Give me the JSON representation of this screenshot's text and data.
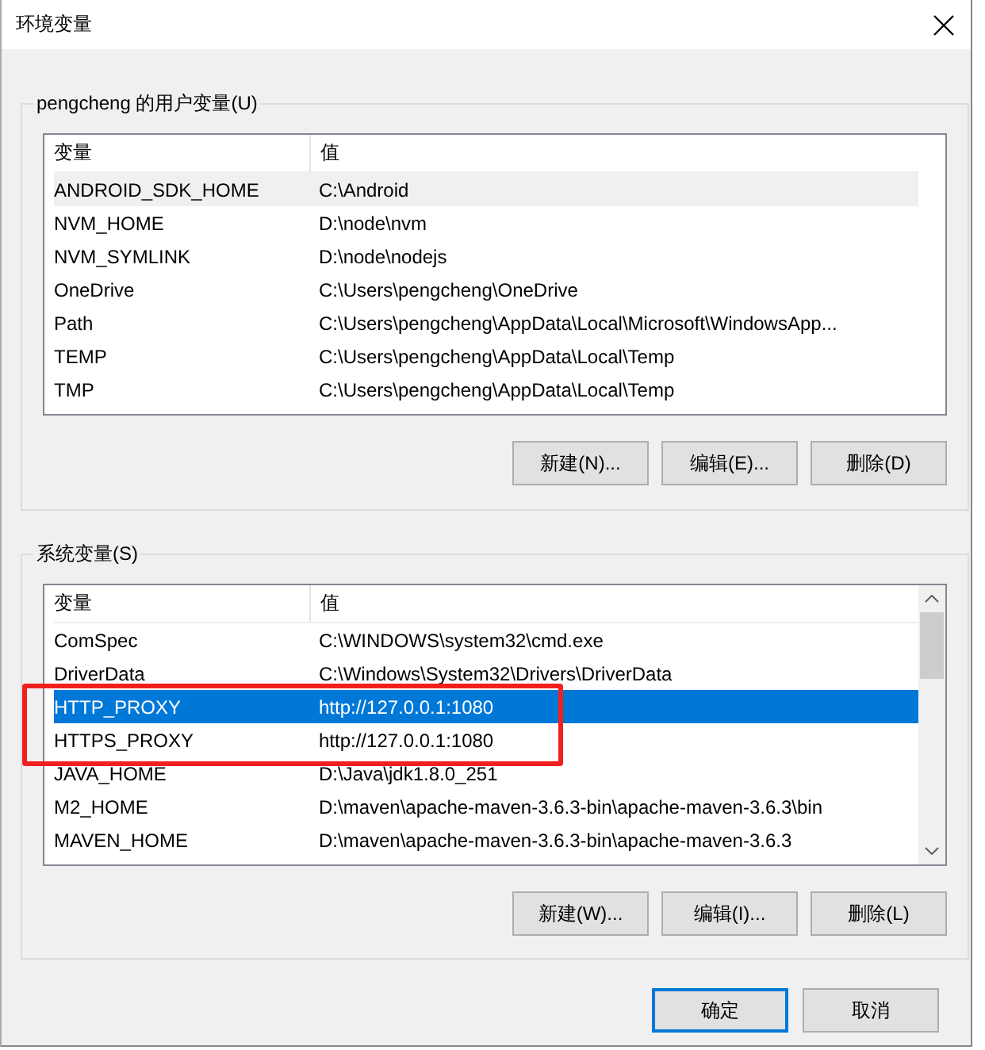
{
  "window": {
    "title": "环境变量"
  },
  "user_variables": {
    "label": "pengcheng 的用户变量(U)",
    "focused": false,
    "scrollbar": false,
    "columns": [
      "变量",
      "值"
    ],
    "rows": [
      {
        "name": "ANDROID_SDK_HOME",
        "value": "C:\\Android",
        "selected": true
      },
      {
        "name": "NVM_HOME",
        "value": "D:\\node\\nvm",
        "selected": false
      },
      {
        "name": "NVM_SYMLINK",
        "value": "D:\\node\\nodejs",
        "selected": false
      },
      {
        "name": "OneDrive",
        "value": "C:\\Users\\pengcheng\\OneDrive",
        "selected": false
      },
      {
        "name": "Path",
        "value": "C:\\Users\\pengcheng\\AppData\\Local\\Microsoft\\WindowsApp...",
        "selected": false
      },
      {
        "name": "TEMP",
        "value": "C:\\Users\\pengcheng\\AppData\\Local\\Temp",
        "selected": false
      },
      {
        "name": "TMP",
        "value": "C:\\Users\\pengcheng\\AppData\\Local\\Temp",
        "selected": false
      }
    ],
    "buttons": [
      "新建(N)...",
      "编辑(E)...",
      "删除(D)"
    ]
  },
  "system_variables": {
    "label": "系统变量(S)",
    "focused": true,
    "scrollbar": true,
    "columns": [
      "变量",
      "值"
    ],
    "rows": [
      {
        "name": "ComSpec",
        "value": "C:\\WINDOWS\\system32\\cmd.exe",
        "selected": false
      },
      {
        "name": "DriverData",
        "value": "C:\\Windows\\System32\\Drivers\\DriverData",
        "selected": false
      },
      {
        "name": "HTTP_PROXY",
        "value": "http://127.0.0.1:1080",
        "selected": true
      },
      {
        "name": "HTTPS_PROXY",
        "value": "http://127.0.0.1:1080",
        "selected": false
      },
      {
        "name": "JAVA_HOME",
        "value": "D:\\Java\\jdk1.8.0_251",
        "selected": false
      },
      {
        "name": "M2_HOME",
        "value": "D:\\maven\\apache-maven-3.6.3-bin\\apache-maven-3.6.3\\bin",
        "selected": false
      },
      {
        "name": "MAVEN_HOME",
        "value": "D:\\maven\\apache-maven-3.6.3-bin\\apache-maven-3.6.3",
        "selected": false
      }
    ],
    "buttons": [
      "新建(W)...",
      "编辑(I)...",
      "删除(L)"
    ]
  },
  "dialog_buttons": [
    {
      "label": "确定",
      "default": true
    },
    {
      "label": "取消",
      "default": false
    }
  ]
}
